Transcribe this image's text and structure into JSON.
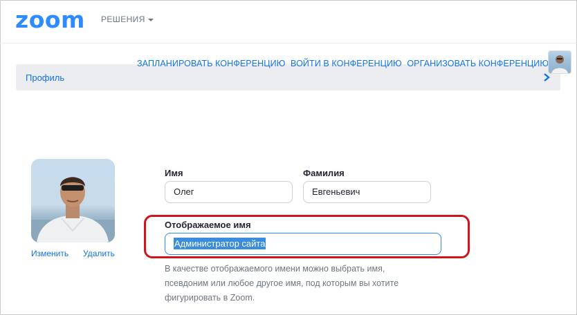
{
  "header": {
    "logo_text": "zoom",
    "solutions_label": "РЕШЕНИЯ"
  },
  "nav": {
    "schedule": "ЗАПЛАНИРОВАТЬ КОНФЕРЕНЦИЮ",
    "join": "ВОЙТИ В КОНФЕРЕНЦИЮ",
    "host": "ОРГАНИЗОВАТЬ КОНФЕРЕНЦИЮ"
  },
  "breadcrumb": {
    "label": "Профиль"
  },
  "profile": {
    "photo_change": "Изменить",
    "photo_delete": "Удалить",
    "first_name_label": "Имя",
    "first_name_value": "Олег",
    "last_name_label": "Фамилия",
    "last_name_value": "Евгеньевич",
    "display_name_label": "Отображаемое имя",
    "display_name_value": "Администратор сайта",
    "display_name_hint_1": "В качестве отображаемого имени можно выбрать имя,",
    "display_name_hint_2": "псевдоним или любое другое имя, под которым вы хотите",
    "display_name_hint_3": "фигурировать в Zoom."
  },
  "colors": {
    "brand": "#2D8CFF",
    "link": "#0E72ED",
    "highlight": "#d2131a",
    "selection": "#3a8dde"
  }
}
